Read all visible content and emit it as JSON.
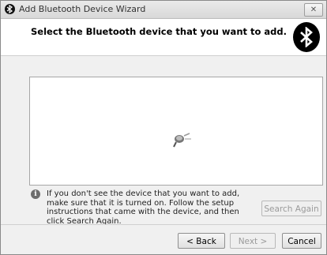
{
  "window": {
    "title": "Add Bluetooth Device Wizard",
    "close_glyph": "✕"
  },
  "header": {
    "title": "Select the Bluetooth device that you want to add.",
    "logo_icon": "bluetooth-icon"
  },
  "device_list": {
    "state": "searching",
    "spinner_icon": "searching-icon"
  },
  "info": {
    "icon": "i",
    "text": "If you don't see the device that you want to add, make sure that it is turned on. Follow the setup instructions that came with the device, and then click Search Again."
  },
  "buttons": {
    "search_again": "Search Again",
    "back": "< Back",
    "next": "Next >",
    "cancel": "Cancel"
  }
}
